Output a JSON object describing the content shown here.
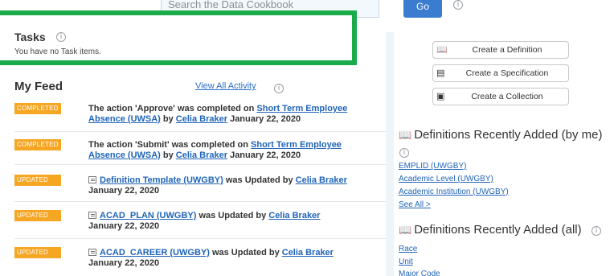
{
  "search": {
    "placeholder": "Search the Data Cookbook",
    "go_label": "Go"
  },
  "tasks": {
    "title": "Tasks",
    "empty_text": "You have no Task items."
  },
  "feed": {
    "title": "My Feed",
    "view_all_label": "View All Activity",
    "items": [
      {
        "badge": "COMPLETED",
        "pre": "The action 'Approve' was completed on ",
        "link": "Short Term Employee Absence (UWSA)",
        "mid": " by ",
        "user": "Celia Braker",
        "date": " January 22, 2020"
      },
      {
        "badge": "COMPLETED",
        "pre": "The action 'Submit' was completed on ",
        "link": "Short Term Employee Absence (UWSA)",
        "mid": " by ",
        "user": "Celia Braker",
        "date": " January 22, 2020"
      },
      {
        "badge": "UPDATED",
        "pre": "",
        "link": "Definition Template (UWGBY)",
        "mid": " was Updated by ",
        "user": "Celia Braker",
        "date": " January 22, 2020"
      },
      {
        "badge": "UPDATED",
        "pre": "",
        "link": "ACAD_PLAN (UWGBY)",
        "mid": " was Updated by ",
        "user": "Celia Braker",
        "date": " January 22, 2020"
      },
      {
        "badge": "UPDATED",
        "pre": "",
        "link": "ACAD_CAREER (UWGBY)",
        "mid": " was Updated by ",
        "user": "Celia Braker",
        "date": " January 22, 2020"
      }
    ]
  },
  "actions": {
    "create_definition": "Create a Definition",
    "create_specification": "Create a Specification",
    "create_collection": "Create a Collection"
  },
  "recent_mine": {
    "title": "Definitions Recently Added (by me)",
    "links": [
      "EMPLID (UWGBY)",
      "Academic Level (UWGBY)",
      "Academic Institution (UWGBY)"
    ],
    "see_all": "See All >"
  },
  "recent_all": {
    "title": "Definitions Recently Added (all)",
    "links": [
      "Race",
      "Unit",
      "Major Code"
    ]
  },
  "colors": {
    "accent": "#1aab4b",
    "badge": "#f5a623",
    "link": "#1f64b8",
    "go_button": "#3a7dd0"
  },
  "icons": [
    "info-icon",
    "book-icon",
    "document-icon",
    "collection-icon",
    "pointer-arrow-icon"
  ]
}
